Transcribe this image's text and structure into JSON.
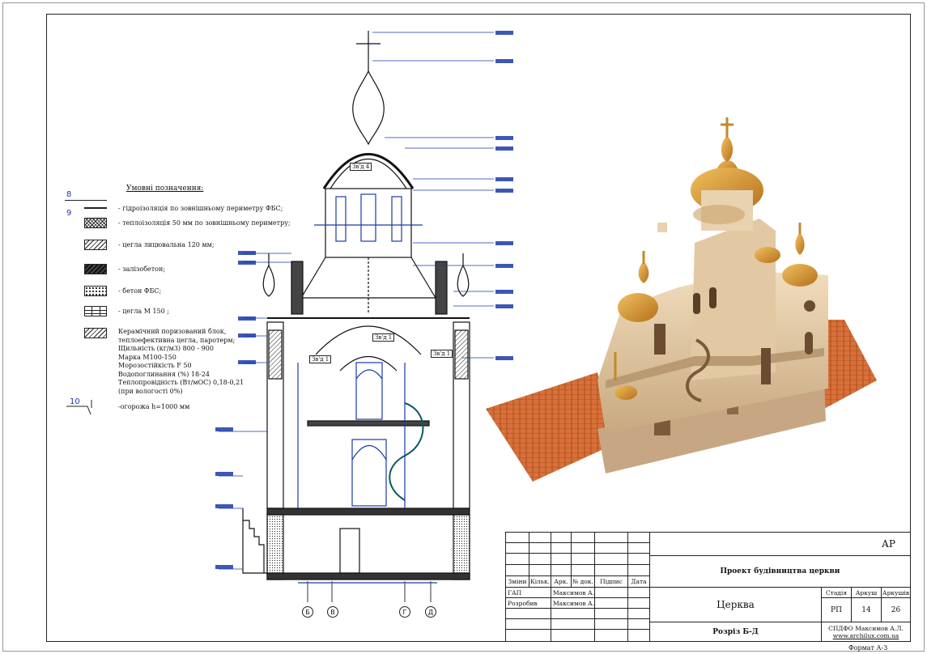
{
  "legend": {
    "title": "Умовні позначення:",
    "items": [
      {
        "num": "8",
        "text": "- гідроізоляція по зовнішньому периметру ФБС;"
      },
      {
        "num": "9",
        "text": "- теплоізоляція 50 мм по зовнішньому периметру;"
      },
      {
        "num": "",
        "text": "- цегла лицювальна  120 мм;"
      },
      {
        "num": "",
        "text": "- залізобетон;"
      },
      {
        "num": "",
        "text": "- бетон ФБС;"
      },
      {
        "num": "",
        "text": "- цегла М 150 ;"
      }
    ],
    "block_lines": [
      "Керамічний поризований блок,",
      "теплоефективна цегла, паротерм;",
      "Щильність (кг/м3) 800 - 900",
      "Марка М100-150",
      "Морозостійкість F 50",
      "Водопоглинання (%) 18-24",
      "Теплопровідність (Вт/мОС) 0,18-0,21",
      "(при вологості 0%)"
    ],
    "railing": {
      "num": "10",
      "text": "-огорожа h=1000 мм"
    }
  },
  "section": {
    "level_labels": [
      "Зв'д 4",
      "Зв'д 1",
      "Зв'д 1",
      "Зв'д 1"
    ],
    "axes": [
      "Б",
      "В",
      "Г",
      "Д"
    ]
  },
  "title_block": {
    "project_code": "АР",
    "project_title": "Проект будівництва  церкви",
    "object": "Церква",
    "sheet_title": "Розріз Б-Д",
    "col_headers": [
      "Зміни",
      "Кільк.",
      "Арк.",
      "№ док.",
      "Підпис",
      "Дата"
    ],
    "roles": [
      {
        "role": "ГАП",
        "name": "Максимов А.Л."
      },
      {
        "role": "Розробив",
        "name": "Максимов А.Л."
      }
    ],
    "stage_label": "Стадія",
    "sheet_label": "Аркуш",
    "sheets_label": "Аркушів",
    "stage": "РП",
    "sheet": "14",
    "sheets": "26",
    "org": "СПДФО  Максимов А.Л.",
    "site": "www.archilux.com.ua",
    "format": "Формат  А-3"
  },
  "colors": {
    "dimension_blue": "#1a3aa8",
    "render_wall": "#e8d2b0",
    "render_roof": "#d9703a",
    "render_gold": "#d7922a"
  }
}
